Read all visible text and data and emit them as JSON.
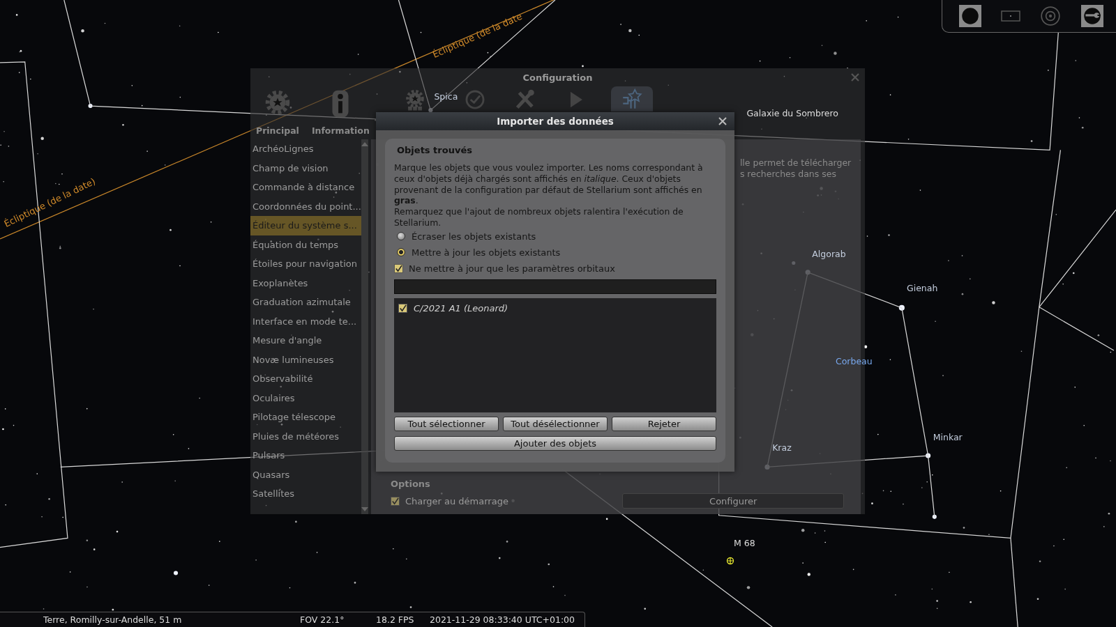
{
  "sky_labels": [
    {
      "text": "Écliptique (de la date",
      "kind": "ecliptic"
    },
    {
      "text": "Écliptique (de la date)",
      "kind": "ecliptic"
    },
    {
      "text": "Spica",
      "kind": "star"
    },
    {
      "text": "Galaxie du Sombrero",
      "kind": "object"
    },
    {
      "text": "Algorab",
      "kind": "star"
    },
    {
      "text": "Gienah",
      "kind": "star"
    },
    {
      "text": "Corbeau",
      "kind": "constellation"
    },
    {
      "text": "Kraz",
      "kind": "star"
    },
    {
      "text": "Minkar",
      "kind": "star"
    },
    {
      "text": "M 68",
      "kind": "object"
    }
  ],
  "config_window": {
    "title": "Configuration",
    "tabs": [
      {
        "label": "Principal",
        "selected": false
      },
      {
        "label": "Information",
        "selected": false
      },
      {
        "selected": false
      },
      {
        "selected": false
      },
      {
        "selected": false
      },
      {
        "selected": false
      },
      {
        "selected": true
      }
    ],
    "sidebar": {
      "items": [
        {
          "label": "ArchéoLignes",
          "selected": false
        },
        {
          "label": "Champ de vision",
          "selected": false
        },
        {
          "label": "Commande à distance",
          "selected": false
        },
        {
          "label": "Coordonnées du point...",
          "selected": false
        },
        {
          "label": "Éditeur du système s...",
          "selected": true
        },
        {
          "label": "Équation du temps",
          "selected": false
        },
        {
          "label": "Étoiles pour navigation",
          "selected": false
        },
        {
          "label": "Exoplanètes",
          "selected": false
        },
        {
          "label": "Graduation azimutale",
          "selected": false
        },
        {
          "label": "Interface en mode te...",
          "selected": false
        },
        {
          "label": "Mesure d'angle",
          "selected": false
        },
        {
          "label": "Novæ lumineuses",
          "selected": false
        },
        {
          "label": "Observabilité",
          "selected": false
        },
        {
          "label": "Oculaires",
          "selected": false
        },
        {
          "label": "Pilotage télescope",
          "selected": false
        },
        {
          "label": "Pluies de météores",
          "selected": false
        },
        {
          "label": "Pulsars",
          "selected": false
        },
        {
          "label": "Quasars",
          "selected": false
        },
        {
          "label": "Satellites",
          "selected": false
        }
      ]
    },
    "panel": {
      "fragments": [
        "lle permet de télécharger",
        "s recherches dans ses"
      ],
      "options": {
        "title": "Options",
        "checkbox": {
          "label": "Charger au démarrage",
          "checked": true
        },
        "button": "Configurer"
      }
    }
  },
  "import_dialog": {
    "title": "Importer des données",
    "section_title": "Objets trouvés",
    "description": "Marque les objets que vous voulez importer. Les noms correspondant à ceux d'objets déjà chargés sont affichés en *italique*. Ceux d'objets provenant de la configuration par défaut de Stellarium sont affichés en **gras**.",
    "notice": "Remarquez que l'ajout de nombreux objets ralentira l'exécution de Stellarium.",
    "radios": [
      {
        "label": "Écraser les objets existants",
        "selected": false
      },
      {
        "label": "Mettre à jour les objets existants",
        "selected": true
      }
    ],
    "checkbox": {
      "label": "Ne mettre à jour que les paramètres orbitaux",
      "checked": true
    },
    "objects": [
      {
        "name": "C/2021 A1 (Leonard)",
        "checked": true
      }
    ],
    "buttons": [
      "Tout sélectionner",
      "Tout désélectionner",
      "Rejeter"
    ],
    "add_button": "Ajouter des objets"
  },
  "status_bar": {
    "location": "Terre, Romilly-sur-Andelle, 51 m",
    "fov": "FOV 22.1°",
    "fps": "18.2 FPS",
    "datetime": "2021-11-29 08:33:40 UTC+01:00"
  }
}
